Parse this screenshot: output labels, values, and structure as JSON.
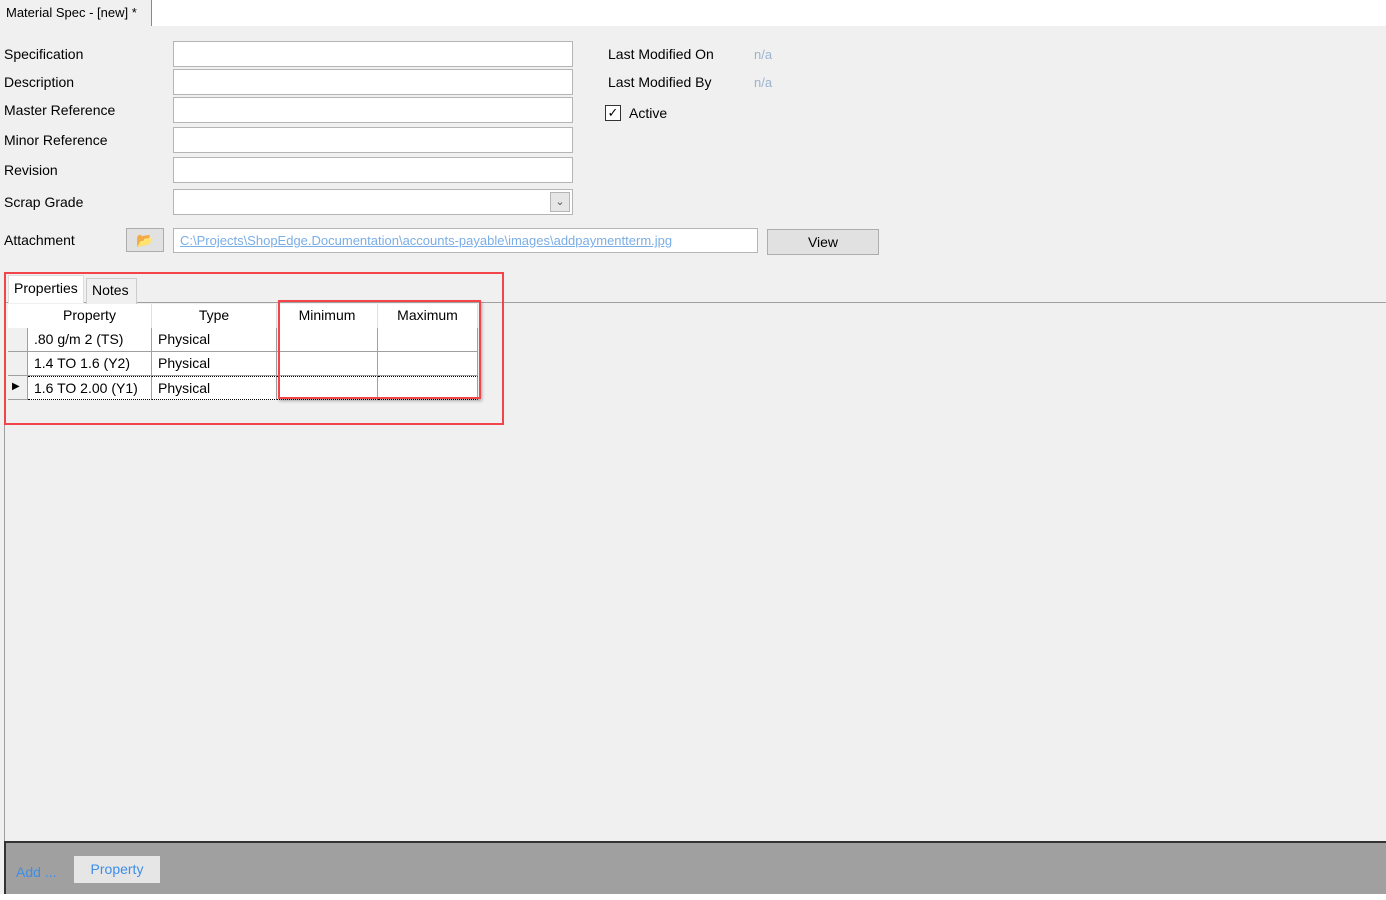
{
  "window": {
    "tab_title": "Material Spec - [new] *"
  },
  "form": {
    "specification": {
      "label": "Specification",
      "value": ""
    },
    "description": {
      "label": "Description",
      "value": ""
    },
    "master_reference": {
      "label": "Master Reference",
      "value": ""
    },
    "minor_reference": {
      "label": "Minor Reference",
      "value": ""
    },
    "revision": {
      "label": "Revision",
      "value": ""
    },
    "scrap_grade": {
      "label": "Scrap Grade",
      "value": ""
    },
    "attachment": {
      "label": "Attachment",
      "path": "C:\\Projects\\ShopEdge.Documentation\\accounts-payable\\images\\addpaymentterm.jpg",
      "view_label": "View",
      "browse_icon": "folder-open-icon"
    },
    "last_modified_on": {
      "label": "Last Modified On",
      "value": "n/a"
    },
    "last_modified_by": {
      "label": "Last Modified By",
      "value": "n/a"
    },
    "active": {
      "label": "Active",
      "checked": true
    }
  },
  "tabs": [
    {
      "label": "Properties",
      "active": true
    },
    {
      "label": "Notes",
      "active": false
    }
  ],
  "grid": {
    "columns": [
      "Property",
      "Type",
      "Minimum",
      "Maximum"
    ],
    "rows": [
      {
        "property": ".80 g/m 2 (TS)",
        "type": "Physical",
        "minimum": "",
        "maximum": ""
      },
      {
        "property": "1.4 TO 1.6 (Y2)",
        "type": "Physical",
        "minimum": "",
        "maximum": ""
      },
      {
        "property": "1.6 TO 2.00 (Y1)",
        "type": "Physical",
        "minimum": "",
        "maximum": "",
        "current": true
      }
    ]
  },
  "footer": {
    "add_label": "Add ...",
    "property_button": "Property"
  },
  "colors": {
    "highlight": "#f2454a",
    "link": "#3d8ee8",
    "footer_bg": "#a0a0a0"
  }
}
